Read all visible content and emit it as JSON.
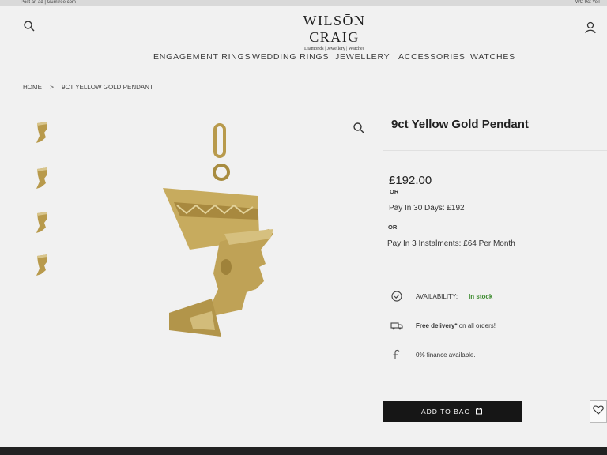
{
  "browser": {
    "tab_left": "Post an ad | Gumtree.com",
    "tab_right": "WC 9ct Yell"
  },
  "header": {
    "brand": "WILSŌN CRAIG",
    "tagline": "Diamonds | Jewellery | Watches"
  },
  "nav": {
    "items": [
      "ENGAGEMENT RINGS",
      "WEDDING RINGS",
      "JEWELLERY",
      "ACCESSORIES",
      "WATCHES"
    ]
  },
  "breadcrumb": {
    "home": "HOME",
    "separator": ">",
    "current": "9CT YELLOW GOLD PENDANT"
  },
  "product": {
    "title": "9ct Yellow Gold Pendant",
    "price": "£192.00",
    "or_label": "OR",
    "pay30": "Pay In 30 Days: £192",
    "pay3": "Pay In 3 Instalments: £64 Per Month",
    "availability_label": "AVAILABILITY:",
    "availability_value": "In stock",
    "delivery_bold": "Free delivery*",
    "delivery_rest": " on all orders!",
    "finance": "0% finance available.",
    "add_to_bag": "ADD TO BAG"
  },
  "colors": {
    "gold": "#b89a4c",
    "in_stock": "#3d8b2f",
    "button_bg": "#161616"
  }
}
